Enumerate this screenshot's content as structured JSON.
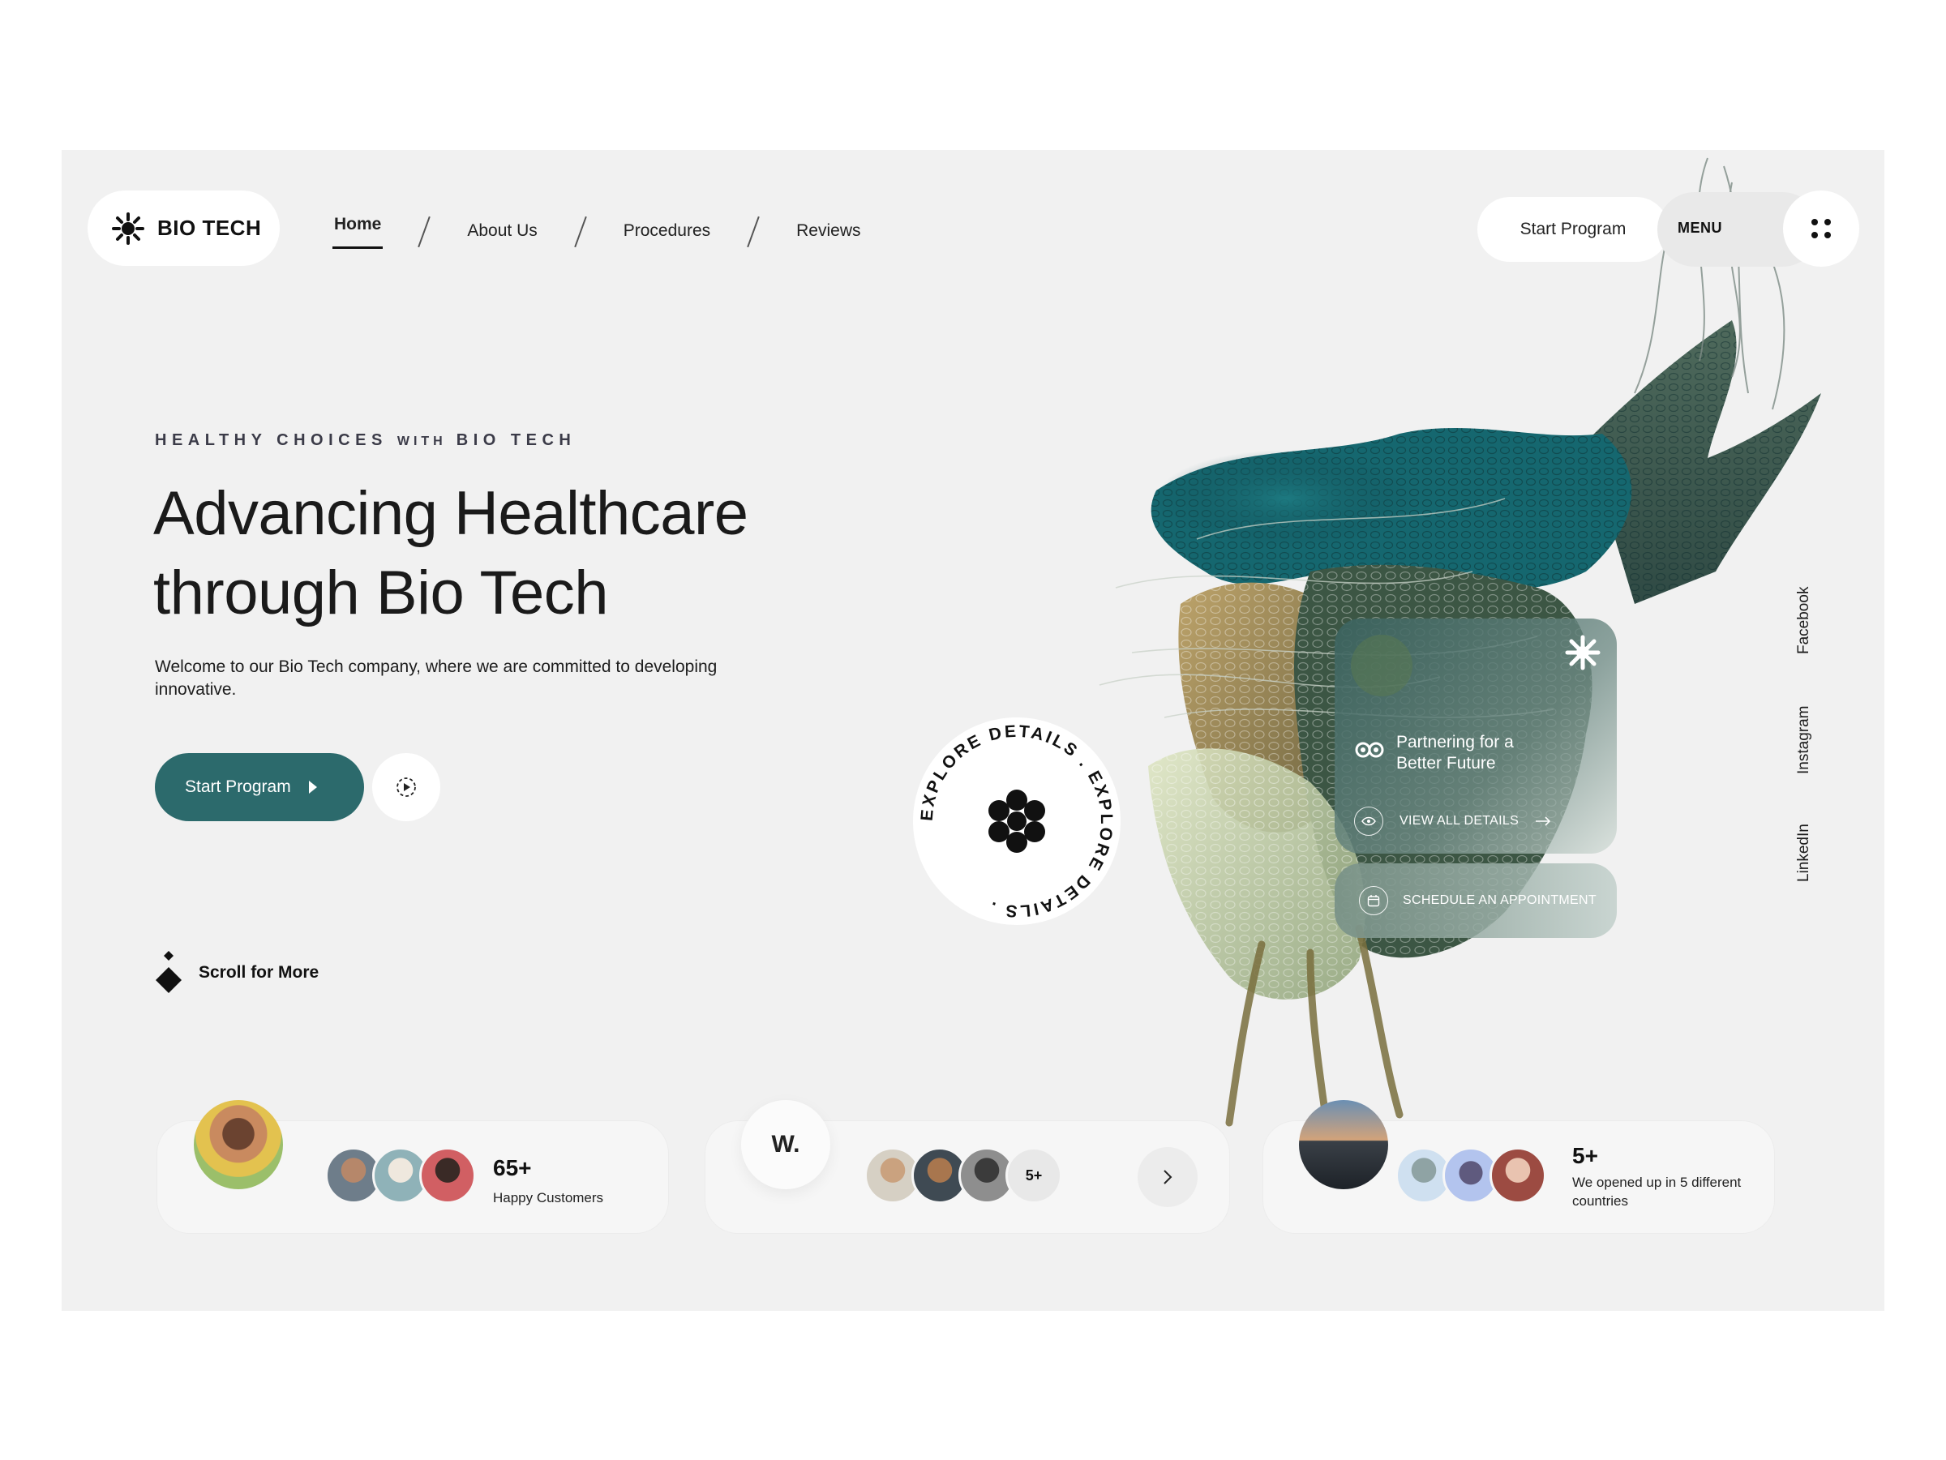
{
  "header": {
    "logo_text": "BIO TECH",
    "nav": [
      {
        "label": "Home",
        "active": true
      },
      {
        "label": "About Us",
        "active": false
      },
      {
        "label": "Procedures",
        "active": false
      },
      {
        "label": "Reviews",
        "active": false
      }
    ],
    "start_program": "Start Program",
    "menu_label": "MENU"
  },
  "hero": {
    "kicker_part1": "HEALTHY CHOICES",
    "kicker_part2": "WITH",
    "kicker_part3": "BIO TECH",
    "headline_line1": "Advancing Healthcare",
    "headline_line2": "through Bio Tech",
    "subtext": "Welcome to our Bio Tech company, where we are committed to developing innovative.",
    "cta_label": "Start Program",
    "scroll_label": "Scroll for More"
  },
  "badge": {
    "ring_text": "EXPLORE DETAILS . EXPLORE DETAILS . "
  },
  "card": {
    "title_line1": "Partnering for a",
    "title_line2": "Better Future",
    "link": "VIEW ALL DETAILS",
    "schedule": "SCHEDULE AN APPOINTMENT"
  },
  "social": [
    "Facebook",
    "Instagram",
    "LinkedIn"
  ],
  "stats": {
    "customers": {
      "value": "65+",
      "caption": "Happy Customers"
    },
    "partners": {
      "logo": "W.",
      "more": "5+"
    },
    "countries": {
      "value": "5+",
      "caption_line1": "We opened up in 5 different",
      "caption_line2": "countries"
    }
  },
  "colors": {
    "accent": "#2c6a6c",
    "background": "#f1f1f1",
    "card_bg": "#f6f6f6"
  },
  "icons": [
    "bio-tech-logo-icon",
    "menu-dots-icon",
    "play-icon",
    "scroll-diamond-icon",
    "flower-icon",
    "star-icon",
    "infinity-icon",
    "eye-icon",
    "arrow-right-icon",
    "calendar-icon",
    "chevron-right-icon"
  ]
}
